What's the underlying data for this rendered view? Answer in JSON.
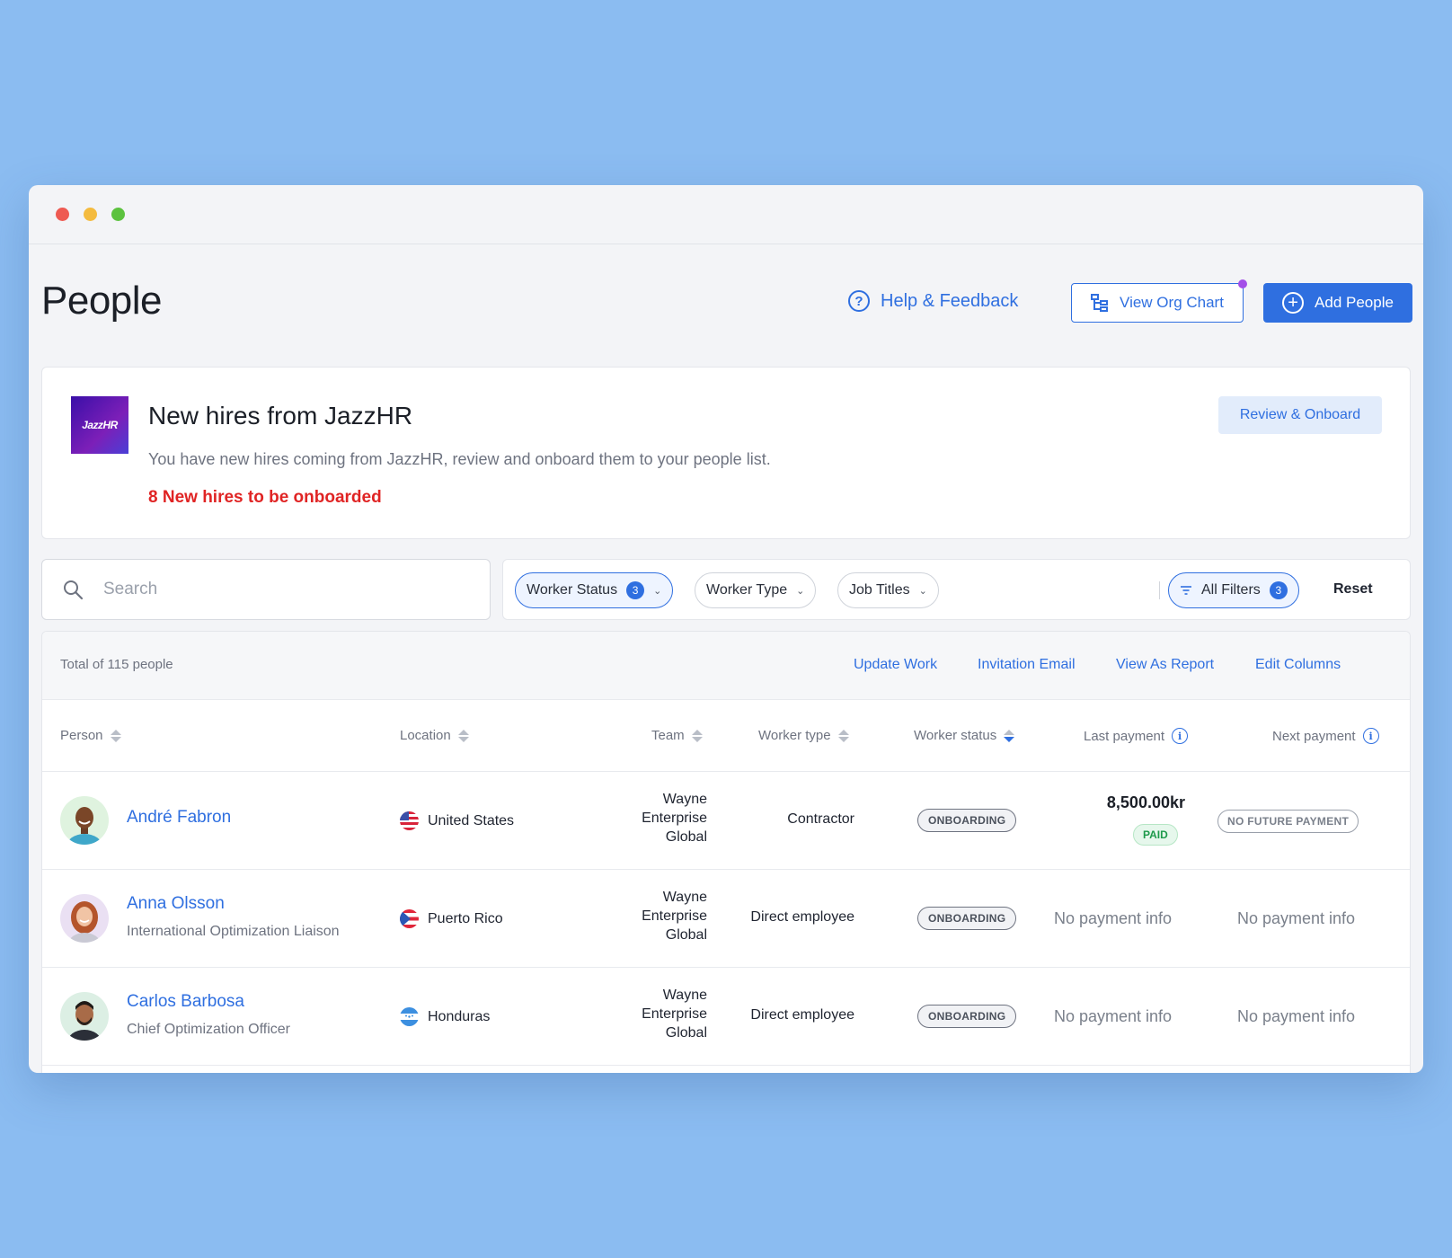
{
  "page": {
    "title": "People",
    "help_label": "Help & Feedback",
    "org_chart_label": "View Org Chart",
    "add_people_label": "Add People"
  },
  "banner": {
    "logo_text": "JazzHR",
    "title": "New hires from JazzHR",
    "description": "You have new hires coming from JazzHR, review and onboard them to your people list.",
    "count_text": "8 New hires to be onboarded",
    "review_label": "Review & Onboard"
  },
  "search": {
    "placeholder": "Search",
    "value": ""
  },
  "filters": {
    "worker_status": {
      "label": "Worker Status",
      "count": "3"
    },
    "worker_type": {
      "label": "Worker Type"
    },
    "job_titles": {
      "label": "Job Titles"
    },
    "all_filters": {
      "label": "All Filters",
      "count": "3"
    },
    "reset_label": "Reset"
  },
  "table": {
    "total_text": "Total of 115 people",
    "actions": {
      "update_work": "Update Work",
      "invitation_email": "Invitation Email",
      "view_as_report": "View As Report",
      "edit_columns": "Edit Columns"
    },
    "columns": {
      "person": "Person",
      "location": "Location",
      "team": "Team",
      "worker_type": "Worker type",
      "worker_status": "Worker status",
      "last_payment": "Last payment",
      "next_payment": "Next payment"
    },
    "rows": [
      {
        "name": "André Fabron",
        "title": "",
        "location": "United States",
        "flag": "us-flag",
        "team_line1": "Wayne",
        "team_line2": "Enterprise",
        "team_line3": "Global",
        "worker_type": "Contractor",
        "status": "ONBOARDING",
        "last_payment": "8,500.00kr",
        "last_payment_status": "PAID",
        "next_payment": "NO FUTURE PAYMENT"
      },
      {
        "name": "Anna Olsson",
        "title": "International Optimization Liaison",
        "location": "Puerto Rico",
        "flag": "puerto-rico-flag",
        "team_line1": "Wayne",
        "team_line2": "Enterprise",
        "team_line3": "Global",
        "worker_type": "Direct employee",
        "status": "ONBOARDING",
        "last_payment": "No payment info",
        "next_payment": "No payment info"
      },
      {
        "name": "Carlos Barbosa",
        "title": "Chief Optimization Officer",
        "location": "Honduras",
        "flag": "honduras-flag",
        "team_line1": "Wayne",
        "team_line2": "Enterprise",
        "team_line3": "Global",
        "worker_type": "Direct employee",
        "status": "ONBOARDING",
        "last_payment": "No payment info",
        "next_payment": "No payment info"
      }
    ]
  },
  "colors": {
    "accent": "#2f6fe0",
    "alert": "#e02424",
    "background": "#8bbcf1",
    "paid": "#1e9a4b"
  }
}
